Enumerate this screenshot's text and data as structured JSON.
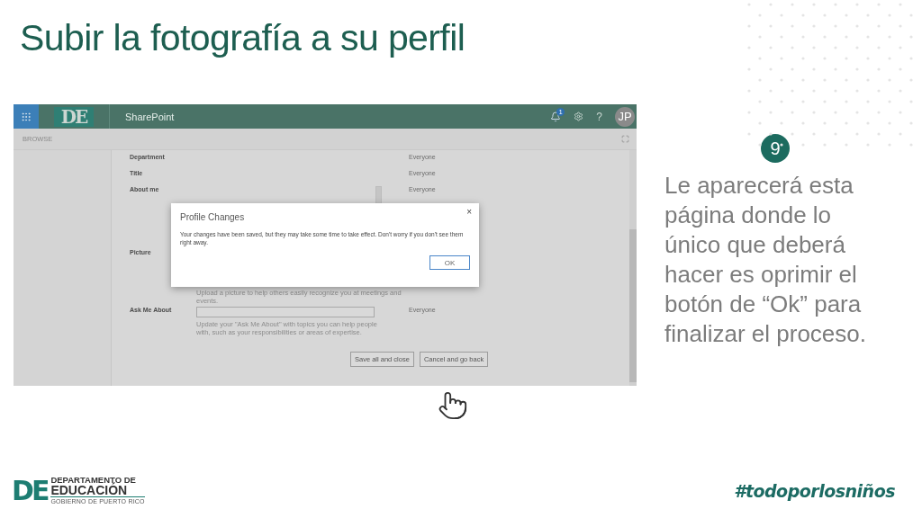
{
  "slide": {
    "title": "Subir la fotografía a su perfil",
    "step": "9",
    "instructions": "Le aparecerá esta página donde lo único que deberá hacer es oprimir el botón de “Ok” para finalizar el proceso.",
    "hashtag": "#todoporlosniños",
    "footer_logo": {
      "mark": "DE",
      "line1": "DEPARTAMENTO DE",
      "line2": "EDUCACIÓN",
      "line3": "GOBIERNO DE PUERTO RICO"
    }
  },
  "screenshot": {
    "logo_text": "DE",
    "app_name": "SharePoint",
    "notification_count": "1",
    "help": "?",
    "avatar_initials": "JP",
    "ribbon_tab": "BROWSE",
    "fields": [
      {
        "label": "Department",
        "kind": "plain",
        "visibility": "Everyone"
      },
      {
        "label": "Title",
        "kind": "plain",
        "visibility": "Everyone"
      },
      {
        "label": "About me",
        "kind": "richtext",
        "visibility": "Everyone"
      },
      {
        "label": "Picture",
        "kind": "picture",
        "hint": "Upload a picture to help others easily recognize you at meetings and events."
      },
      {
        "label": "Ask Me About",
        "kind": "input",
        "visibility": "Everyone",
        "hint": "Update your \"Ask Me About\" with topics you can help people with, such as your responsibilities or areas of expertise."
      }
    ],
    "buttons": [
      "Save all and close",
      "Cancel and go back"
    ],
    "dialog": {
      "title": "Profile Changes",
      "close": "×",
      "message": "Your changes have been saved, but they may take some time to take effect. Don't worry if you don't see them right away.",
      "button": "OK"
    }
  }
}
